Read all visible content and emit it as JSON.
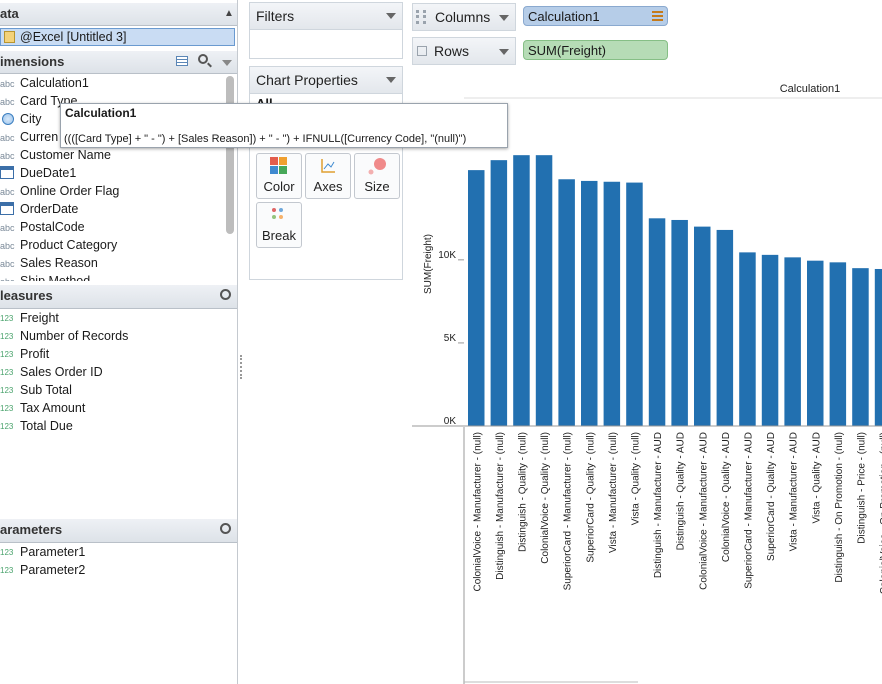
{
  "data_panel": {
    "title": "ata",
    "source": "@Excel [Untitled 3]",
    "dimensions_title": "imensions",
    "dimensions": [
      {
        "tag": "abc",
        "label": "Calculation1"
      },
      {
        "tag": "abc",
        "label": "Card Type"
      },
      {
        "tag": "globe",
        "label": "City"
      },
      {
        "tag": "abc",
        "label": "Curren"
      },
      {
        "tag": "abc",
        "label": "Customer Name"
      },
      {
        "tag": "date",
        "label": "DueDate1"
      },
      {
        "tag": "abc",
        "label": "Online Order Flag"
      },
      {
        "tag": "date",
        "label": "OrderDate"
      },
      {
        "tag": "abc",
        "label": "PostalCode"
      },
      {
        "tag": "abc",
        "label": "Product Category"
      },
      {
        "tag": "abc",
        "label": "Sales Reason"
      },
      {
        "tag": "abc",
        "label": "Ship Method"
      }
    ],
    "measures_title": "leasures",
    "measures": [
      {
        "tag": "123",
        "label": "Freight"
      },
      {
        "tag": "123",
        "label": "Number of Records"
      },
      {
        "tag": "123",
        "label": "Profit"
      },
      {
        "tag": "123",
        "label": "Sales Order ID"
      },
      {
        "tag": "123",
        "label": "Sub Total"
      },
      {
        "tag": "123",
        "label": "Tax Amount"
      },
      {
        "tag": "123",
        "label": "Total Due"
      }
    ],
    "parameters_title": "arameters",
    "parameters": [
      {
        "tag": "123",
        "label": "Parameter1"
      },
      {
        "tag": "123",
        "label": "Parameter2"
      }
    ]
  },
  "filters": {
    "title": "Filters"
  },
  "chart_properties": {
    "title": "Chart Properties",
    "all_label": "All",
    "tiles": [
      {
        "label": "Color",
        "icon": "color-grid-icon"
      },
      {
        "label": "Axes",
        "icon": "axes-icon"
      },
      {
        "label": "Size",
        "icon": "size-dots-icon"
      },
      {
        "label": "Break",
        "icon": "break-dots-icon"
      }
    ]
  },
  "columns_shelf": {
    "label": "Columns",
    "pill": "Calculation1"
  },
  "rows_shelf": {
    "label": "Rows",
    "pill": "SUM(Freight)"
  },
  "tooltip": {
    "title": "Calculation1",
    "formula": "((([Card Type] + \" - \") + [Sales Reason]) + \" - \") + IFNULL([Currency Code], \"(null)\")"
  },
  "chart_data": {
    "type": "bar",
    "title": "",
    "column_header": "Calculation1",
    "ylabel": "SUM(Freight)",
    "ylim": [
      0,
      19500
    ],
    "yticks": [
      0,
      5000,
      10000
    ],
    "ytick_labels": [
      "0K",
      "5K",
      "10K"
    ],
    "color": "#2270b0",
    "categories": [
      "ColonialVoice - Manufacturer - (null)",
      "Distinguish - Manufacturer - (null)",
      "Distinguish - Quality - (null)",
      "ColonialVoice - Quality - (null)",
      "SuperiorCard - Manufacturer - (null)",
      "SuperiorCard - Quality - (null)",
      "Vista - Manufacturer - (null)",
      "Vista - Quality - (null)",
      "Distinguish - Manufacturer - AUD",
      "Distinguish - Quality - AUD",
      "ColonialVoice - Manufacturer - AUD",
      "ColonialVoice - Quality - AUD",
      "SuperiorCard - Manufacturer - AUD",
      "SuperiorCard - Quality - AUD",
      "Vista - Manufacturer - AUD",
      "Vista - Quality - AUD",
      "Distinguish - On Promotion - (null)",
      "Distinguish - Price - (null)",
      "ColonialVoice - On Promotion - (null)"
    ],
    "values": [
      15400,
      16000,
      16300,
      16300,
      14850,
      14750,
      14700,
      14650,
      12500,
      12400,
      12000,
      11800,
      10450,
      10300,
      10150,
      9950,
      9850,
      9500,
      9450
    ]
  }
}
